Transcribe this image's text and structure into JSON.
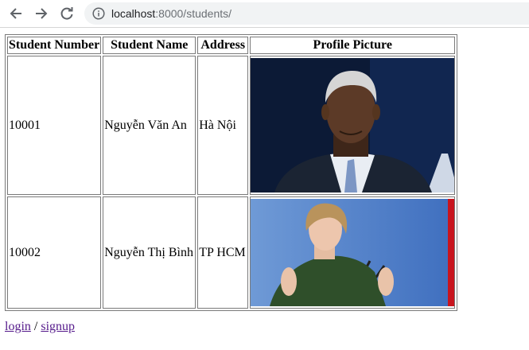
{
  "browser": {
    "url_host": "localhost",
    "url_rest": ":8000/students/",
    "icons": [
      "back-arrow-icon",
      "forward-arrow-icon",
      "reload-icon",
      "info-icon"
    ]
  },
  "table": {
    "headers": [
      "Student Number",
      "Student Name",
      "Address",
      "Profile Picture"
    ],
    "rows": [
      {
        "number": "10001",
        "name": "Nguyễn Văn An",
        "address": "Hà Nội",
        "picture": "profile-photo-man-dark-suit"
      },
      {
        "number": "10002",
        "name": "Nguyễn Thị Bình",
        "address": "TP HCM",
        "picture": "profile-photo-woman-green-jacket"
      }
    ]
  },
  "footer": {
    "login_label": "login",
    "separator": " / ",
    "signup_label": "signup"
  }
}
